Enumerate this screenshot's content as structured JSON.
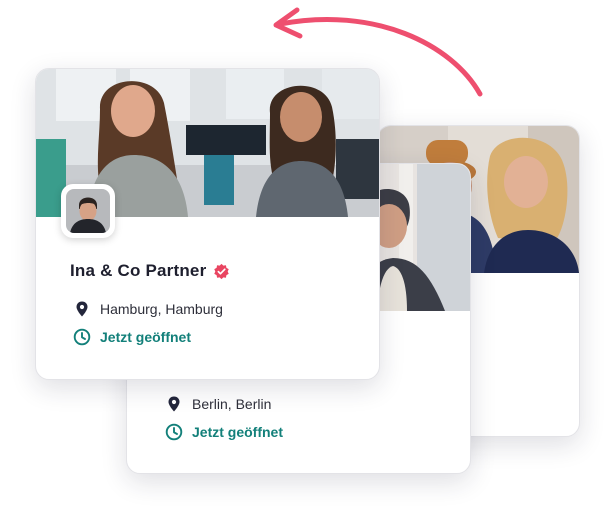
{
  "cards": {
    "front": {
      "name": "Ina & Co Partner",
      "verified": true,
      "location": "Hamburg, Hamburg",
      "status": "Jetzt geöffnet"
    },
    "middle": {
      "location": "Berlin, Berlin",
      "status": "Jetzt geöffnet"
    }
  },
  "icons": {
    "location": "map-pin-icon",
    "status": "clock-icon",
    "verified": "verified-badge-icon",
    "arrow": "curved-arrow-icon"
  },
  "colors": {
    "accent_pink": "#ee4f6f",
    "open_teal": "#13807a",
    "text_dark": "#1e1f2e",
    "pin_navy": "#23263b"
  }
}
